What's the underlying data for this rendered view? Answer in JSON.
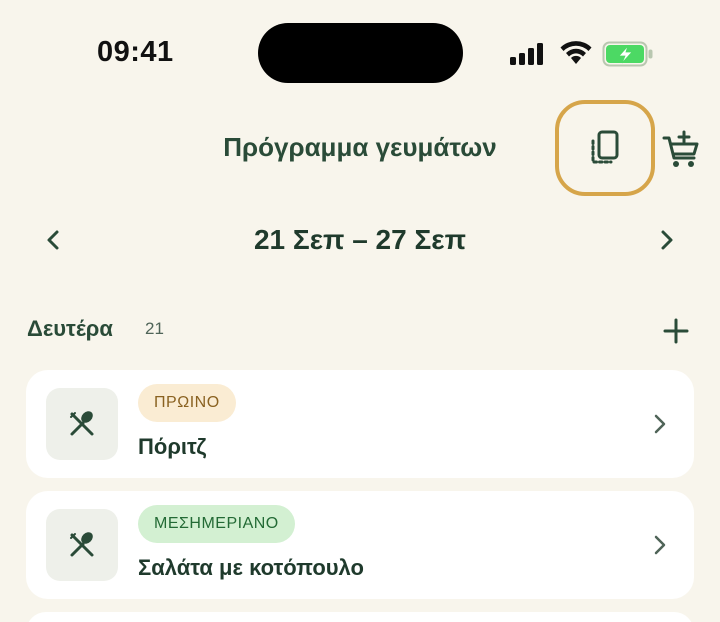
{
  "status_bar": {
    "time": "09:41"
  },
  "header": {
    "title": "Πρόγραμμα γευμάτων",
    "copy_icon": "copy-pages-icon",
    "cart_icon": "cart-add-icon",
    "highlight_color": "#d6a54a"
  },
  "week": {
    "range": "21 Σεπ – 27 Σεπ"
  },
  "day": {
    "name": "Δευτέρα",
    "number": "21"
  },
  "meals": [
    {
      "badge": "ΠΡΩΙΝΟ",
      "title": "Πόριτζ",
      "badge_color": "#faecd3",
      "badge_text_color": "#8a6221"
    },
    {
      "badge": "ΜΕΣΗΜΕΡΙΑΝΟ",
      "title": "Σαλάτα με κοτόπουλο",
      "badge_color": "#d3f0d2",
      "badge_text_color": "#236a35"
    }
  ],
  "colors": {
    "background": "#f8f5ec",
    "primary_text": "#1f3a2c",
    "battery_green": "#4cd964"
  }
}
